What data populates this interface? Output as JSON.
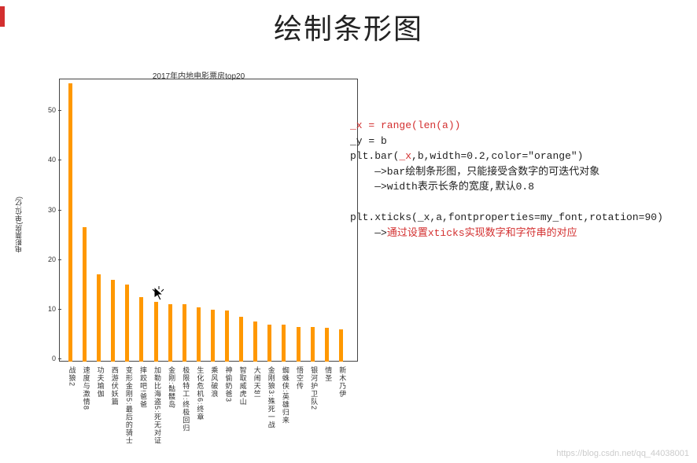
{
  "title": "绘制条形图",
  "chart_data": {
    "type": "bar",
    "title": "2017年内地电影票房top20",
    "ylabel": "电影票房(单位:亿)",
    "ylim": [
      0,
      57
    ],
    "y_ticks": [
      0,
      10,
      20,
      30,
      40,
      50
    ],
    "categories": [
      "战狼2",
      "速度与激情8",
      "功夫瑜伽",
      "西游伏妖篇",
      "变形金刚5:最后的骑士",
      "摔跤吧!爸爸",
      "加勒比海盗5:死无对证",
      "金刚:骷髅岛",
      "极限特工:终极回归",
      "生化危机6:终章",
      "乘风破浪",
      "神偷奶爸3",
      "智取威虎山",
      "大闹天竺",
      "金刚狼3:殊死一战",
      "蜘蛛侠:英雄归来",
      "悟空传",
      "银河护卫队2",
      "情圣",
      "新木乃伊"
    ],
    "values": [
      56,
      27,
      17.5,
      16.5,
      15.5,
      13,
      12,
      11.5,
      11.5,
      11,
      10.5,
      10.3,
      9,
      8,
      7.5,
      7.5,
      7,
      7,
      6.8,
      6.5
    ],
    "bar_color": "#ff9800"
  },
  "code": {
    "l1": "_x = range(len(a))",
    "l2": "_y = b",
    "l3a": "plt.bar(",
    "l3b": "_x",
    "l3c": ",b,width=0.2,color=\"orange\")",
    "l4": "    —>bar绘制条形图，只能接受含数字的可迭代对象",
    "l5": "    —>width表示长条的宽度,默认0.8",
    "l6": "plt.xticks(_x,a,fontproperties=my_font,rotation=90)",
    "l7a": "    —>",
    "l7b": "通过设置xticks实现数字和字符串的对应"
  },
  "watermark": "https://blog.csdn.net/qq_44038001"
}
